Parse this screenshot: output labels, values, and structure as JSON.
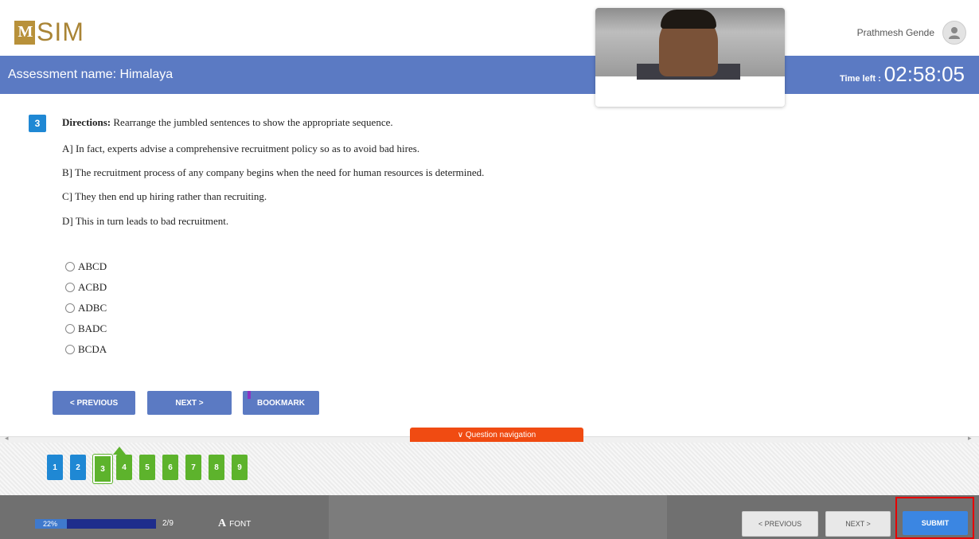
{
  "header": {
    "logo_mark": "M",
    "logo_text": "SIM",
    "user_name": "Prathmesh Gende"
  },
  "assessment": {
    "title": "Assessment name: Himalaya",
    "time_left_label": "Time left :",
    "time_left": "02:58:05"
  },
  "question": {
    "number": "3",
    "directions_label": "Directions:",
    "directions_text": " Rearrange the jumbled sentences to show the appropriate sequence.",
    "sentences": [
      "A] In fact, experts advise a comprehensive recruitment policy so as to avoid bad hires.",
      "B] The recruitment process of any company begins when the need for human resources is determined.",
      "C] They then end up hiring rather than recruiting.",
      "D] This in turn leads to bad recruitment."
    ],
    "options": [
      "ABCD",
      "ACBD",
      "ADBC",
      "BADC",
      "BCDA"
    ]
  },
  "buttons": {
    "previous": "< PREVIOUS",
    "next": "NEXT >",
    "bookmark": "BOOKMARK"
  },
  "navigation": {
    "tab_label": "∨ Question navigation",
    "questions": [
      {
        "n": "1",
        "state": "blue"
      },
      {
        "n": "2",
        "state": "blue"
      },
      {
        "n": "3",
        "state": "green"
      },
      {
        "n": "4",
        "state": "green"
      },
      {
        "n": "5",
        "state": "green"
      },
      {
        "n": "6",
        "state": "green"
      },
      {
        "n": "7",
        "state": "green"
      },
      {
        "n": "8",
        "state": "green"
      },
      {
        "n": "9",
        "state": "green"
      }
    ],
    "current": "3"
  },
  "footer": {
    "progress_text": "22%",
    "progress_value": 0.26,
    "question_count": "2/9",
    "font_icon": "A",
    "font_label": "FONT",
    "previous": "< PREVIOUS",
    "next": "NEXT >",
    "submit": "SUBMIT"
  },
  "colors": {
    "primary_blue": "#5b7ac3",
    "answered_blue": "#1f88d4",
    "unanswered_green": "#5db32c",
    "nav_tab_orange": "#f04b12",
    "submit_blue": "#3b86e2",
    "highlight_red": "#e60000"
  }
}
